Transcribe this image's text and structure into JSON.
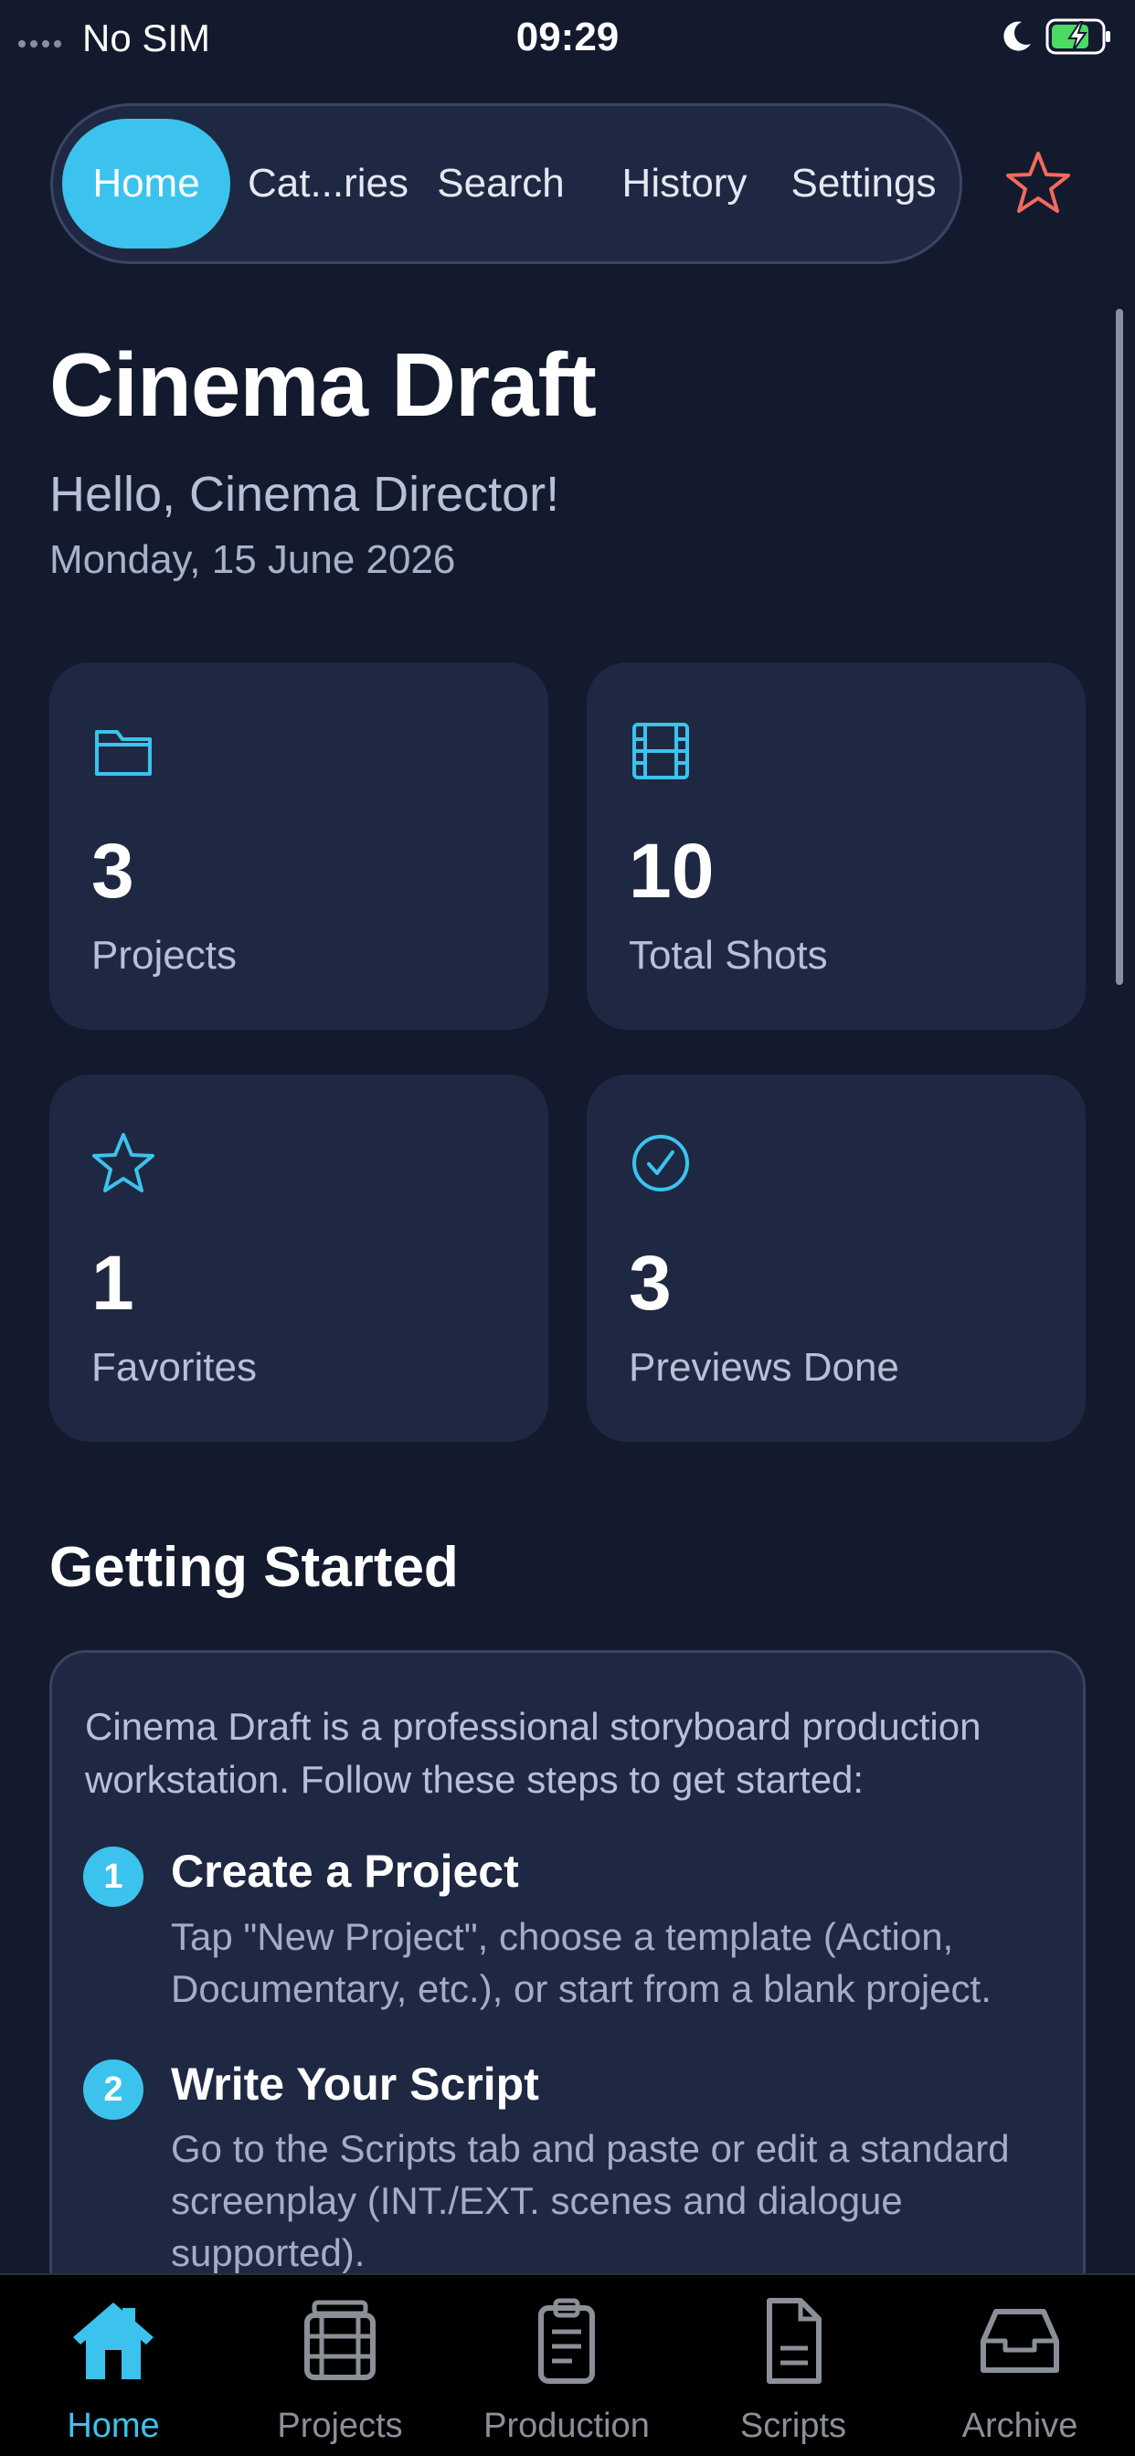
{
  "status_bar": {
    "carrier": "No SIM",
    "time": "09:29"
  },
  "top_nav": {
    "tabs": [
      {
        "label": "Home",
        "active": true
      },
      {
        "label": "Cat...ries",
        "active": false
      },
      {
        "label": "Search",
        "active": false
      },
      {
        "label": "History",
        "active": false
      },
      {
        "label": "Settings",
        "active": false
      }
    ],
    "star_icon": "star-outline-icon"
  },
  "header": {
    "title": "Cinema Draft",
    "greeting": "Hello, Cinema Director!",
    "date": "Monday, 15 June 2026"
  },
  "stats": [
    {
      "icon": "folder-icon",
      "value": "3",
      "label": "Projects"
    },
    {
      "icon": "film-icon",
      "value": "10",
      "label": "Total Shots"
    },
    {
      "icon": "star-icon",
      "value": "1",
      "label": "Favorites"
    },
    {
      "icon": "check-circle-icon",
      "value": "3",
      "label": "Previews Done"
    }
  ],
  "getting_started": {
    "title": "Getting Started",
    "intro": "Cinema Draft is a professional storyboard production workstation. Follow these steps to get started:",
    "steps": [
      {
        "number": "1",
        "title": "Create a Project",
        "body": "Tap \"New Project\", choose a template (Action, Documentary, etc.), or start from a blank project."
      },
      {
        "number": "2",
        "title": "Write Your Script",
        "body": "Go to the Scripts tab and paste or edit a standard screenplay (INT./EXT. scenes and dialogue supported)."
      }
    ]
  },
  "tab_bar": {
    "items": [
      {
        "label": "Home",
        "icon": "home-icon",
        "active": true
      },
      {
        "label": "Projects",
        "icon": "film-reel-icon",
        "active": false
      },
      {
        "label": "Production",
        "icon": "clipboard-icon",
        "active": false
      },
      {
        "label": "Scripts",
        "icon": "document-icon",
        "active": false
      },
      {
        "label": "Archive",
        "icon": "archive-box-icon",
        "active": false
      }
    ]
  },
  "colors": {
    "background": "#131a2e",
    "card": "#1f2842",
    "accent": "#3bc3ee",
    "star": "#f26b5b"
  }
}
